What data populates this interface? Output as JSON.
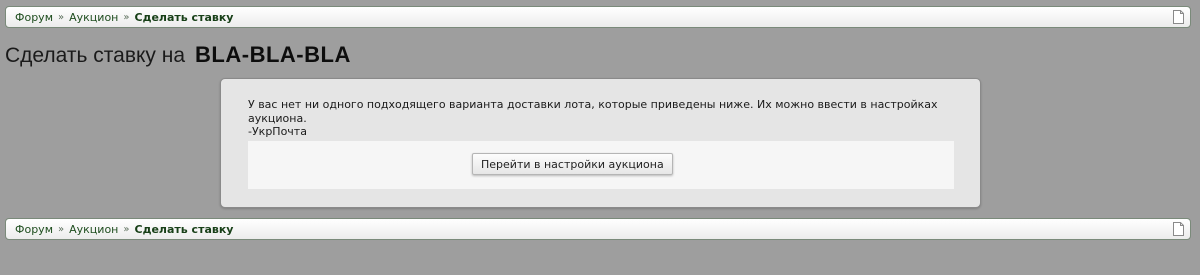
{
  "breadcrumb": {
    "items": [
      "Форум",
      "Аукцион"
    ],
    "separator": "»",
    "current": "Сделать ставку"
  },
  "title": {
    "prefix": "Сделать ставку на",
    "item": "BLA-BLA-BLA"
  },
  "panel": {
    "message_line1": "У вас нет ни одного подходящего варианта доставки лота, которые приведены ниже. Их можно ввести в настройках",
    "message_line2": "аукциона.",
    "delivery_option": "-УкрПочта",
    "button_label": "Перейти в настройки аукциона"
  },
  "colors": {
    "background": "#9e9e9e",
    "link": "#1e4d1e",
    "panel": "#e5e5e5"
  }
}
